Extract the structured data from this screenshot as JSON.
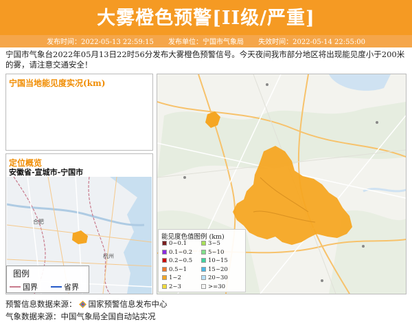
{
  "header": {
    "title": "大雾橙色预警[II级/严重]",
    "publish_time": "发布时间：2022-05-13 22:59:15",
    "publisher": "发布单位：宁国市气象局",
    "expire_time": "失效时间：2022-05-14 22:55:00"
  },
  "description": "宁国市气象台2022年05月13日22时56分发布大雾橙色预警信号。今天夜间我市部分地区将出现能见度小于200米的雾，请注意交通安全！",
  "visibility_panel": {
    "title": "宁国当地能见度实况(km)"
  },
  "location_panel": {
    "title": "定位概览",
    "path": "安徽省-宣城市-宁国市"
  },
  "mini_map": {
    "legend_title": "图例",
    "legend_national": "国界",
    "legend_provincial": "省界",
    "labels": {
      "hefei": "合肥",
      "hangzhou": "杭州"
    }
  },
  "legend": {
    "title": "能见度色值图例 (km)",
    "items": [
      {
        "label": "0~0.1",
        "color": "#7a1f1f"
      },
      {
        "label": "0.1~0.2",
        "color": "#8a2be2"
      },
      {
        "label": "0.2~0.5",
        "color": "#cc0000"
      },
      {
        "label": "0.5~1",
        "color": "#f07a2a"
      },
      {
        "label": "1~2",
        "color": "#f5a623"
      },
      {
        "label": "2~3",
        "color": "#f0dc3c"
      },
      {
        "label": "3~5",
        "color": "#a8e05a"
      },
      {
        "label": "5~10",
        "color": "#7fe08a"
      },
      {
        "label": "10~15",
        "color": "#3fd4a0"
      },
      {
        "label": "15~20",
        "color": "#4ab8e8"
      },
      {
        "label": "20~30",
        "color": "#b8e0f8"
      },
      {
        "label": ">=30",
        "color": "#f4f4f4"
      }
    ]
  },
  "sources": {
    "warning": "预警信息数据来源：",
    "warning_org": "国家预警信息发布中心",
    "weather": "气象数据来源：中国气象局全国自动站实况"
  },
  "colors": {
    "accent": "#f59a23",
    "fog_fill": "#f5a623"
  }
}
